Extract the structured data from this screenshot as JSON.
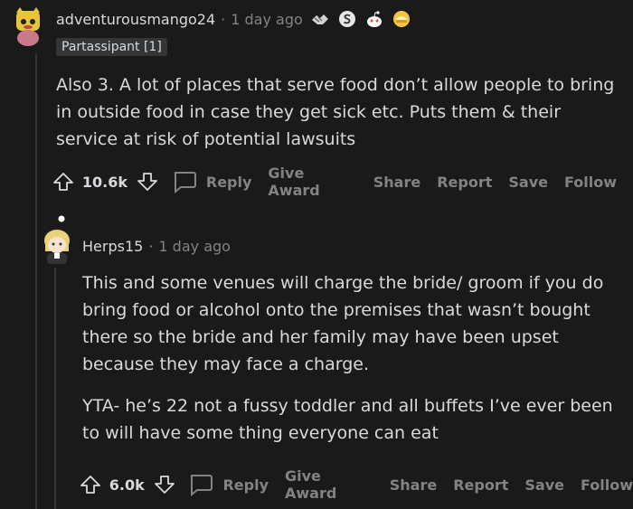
{
  "comment1": {
    "username": "adventurousmango24",
    "separator": "·",
    "time": "1 day ago",
    "flair": "Partassipant [1]",
    "awards": [
      "handshake-award-icon",
      "silver-s-award-icon",
      "snoo-award-icon",
      "helmet-award-icon"
    ],
    "body": [
      "Also 3. A lot of places that serve food don’t allow people to bring in outside food in case they get sick etc. Puts them & their service at risk of potential lawsuits"
    ],
    "score": "10.6k",
    "actions": {
      "reply": "Reply",
      "give_award": "Give Award",
      "share": "Share",
      "report": "Report",
      "save": "Save",
      "follow": "Follow"
    }
  },
  "comment2": {
    "username": "Herps15",
    "separator": "·",
    "time": "1 day ago",
    "body": [
      "This and some venues will charge the bride/ groom if you do bring food or alcohol onto the premises that wasn’t bought there so the bride and her family may have been upset because they may face a charge.",
      "YTA- he’s 22 not a fussy toddler and all buffets I’ve ever been to will have some thing everyone can eat"
    ],
    "score": "6.0k",
    "actions": {
      "reply": "Reply",
      "give_award": "Give Award",
      "share": "Share",
      "report": "Report",
      "save": "Save",
      "follow": "Follow"
    }
  },
  "colors": {
    "background": "#1a1a1b",
    "text": "#d7dadc",
    "muted": "#818384",
    "thread_line": "#343536"
  }
}
